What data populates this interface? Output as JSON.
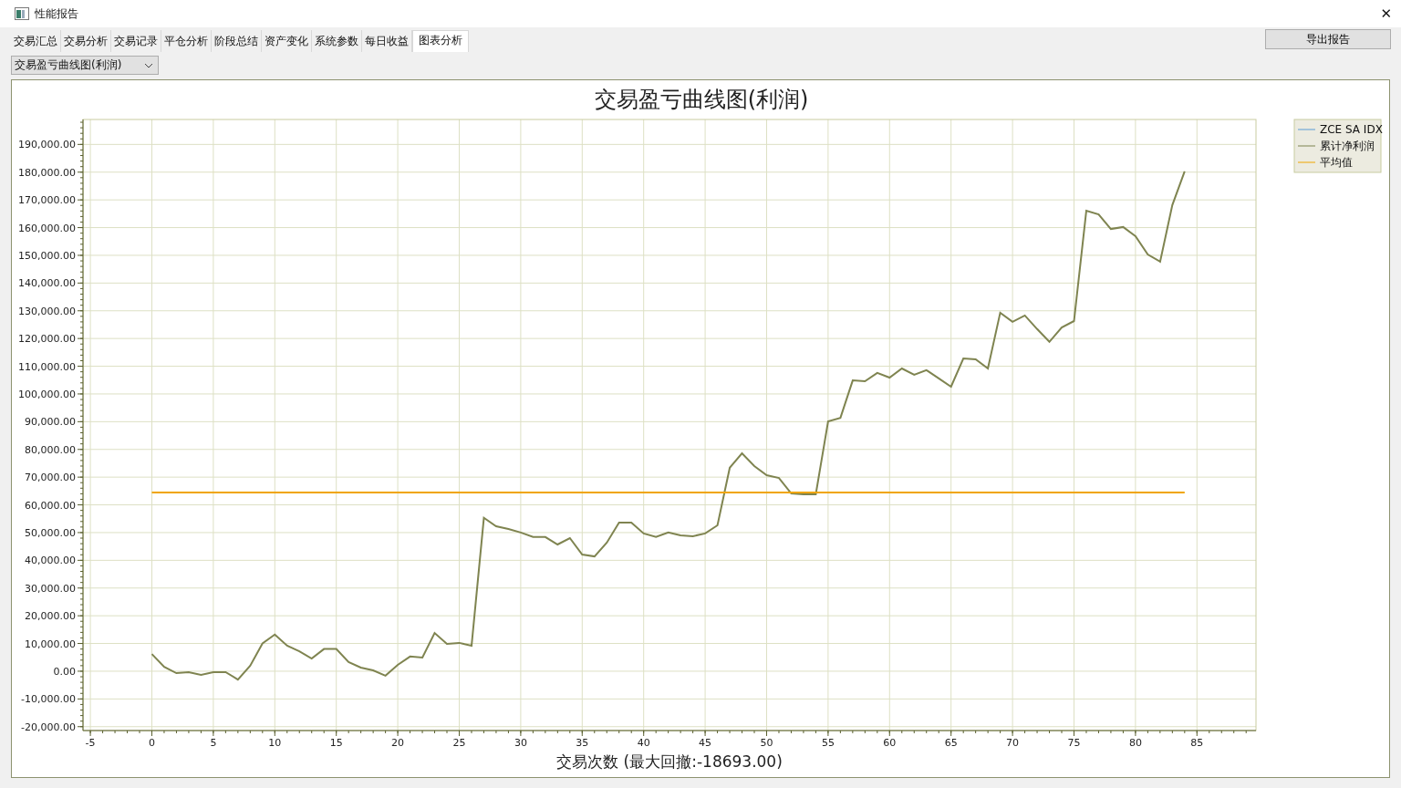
{
  "window": {
    "title": "性能报告",
    "close": "✕"
  },
  "tabs": [
    {
      "label": "交易汇总",
      "selected": false
    },
    {
      "label": "交易分析",
      "selected": false
    },
    {
      "label": "交易记录",
      "selected": false
    },
    {
      "label": "平仓分析",
      "selected": false
    },
    {
      "label": "阶段总结",
      "selected": false
    },
    {
      "label": "资产变化",
      "selected": false
    },
    {
      "label": "系统参数",
      "selected": false
    },
    {
      "label": "每日收益",
      "selected": false
    },
    {
      "label": "图表分析",
      "selected": true
    }
  ],
  "export_button": "导出报告",
  "chart_select": {
    "value": "交易盈亏曲线图(利润)"
  },
  "chart_data": {
    "type": "line",
    "grid": true,
    "legend": "top-right",
    "title": "交易盈亏曲线图(利润)",
    "xlabel": "交易次数 (最大回撤:-18693.00)",
    "x": [
      0,
      1,
      2,
      3,
      4,
      5,
      6,
      7,
      8,
      9,
      10,
      11,
      12,
      13,
      14,
      15,
      16,
      17,
      18,
      19,
      20,
      21,
      22,
      23,
      24,
      25,
      26,
      27,
      28,
      29,
      30,
      31,
      32,
      33,
      34,
      35,
      36,
      37,
      38,
      39,
      40,
      41,
      42,
      43,
      44,
      45,
      46,
      47,
      48,
      49,
      50,
      51,
      52,
      53,
      54,
      55,
      56,
      57,
      58,
      59,
      60,
      61,
      62,
      63,
      64,
      65,
      66,
      67,
      68,
      69,
      70,
      71,
      72,
      73,
      74,
      75,
      76,
      77,
      78,
      79,
      80,
      81,
      82,
      83,
      84
    ],
    "xlim": [
      -5.6,
      89.8
    ],
    "ylim": [
      -21400,
      199000
    ],
    "xticks": [
      -5,
      0,
      5,
      10,
      15,
      20,
      25,
      30,
      35,
      40,
      45,
      50,
      55,
      60,
      65,
      70,
      75,
      80,
      85
    ],
    "yticks": [
      {
        "value": -20000,
        "label": "-20,000.00"
      },
      {
        "value": -10000,
        "label": "-10,000.00"
      },
      {
        "value": 0,
        "label": "0.00"
      },
      {
        "value": 10000,
        "label": "10,000.00"
      },
      {
        "value": 20000,
        "label": "20,000.00"
      },
      {
        "value": 30000,
        "label": "30,000.00"
      },
      {
        "value": 40000,
        "label": "40,000.00"
      },
      {
        "value": 50000,
        "label": "50,000.00"
      },
      {
        "value": 60000,
        "label": "60,000.00"
      },
      {
        "value": 70000,
        "label": "70,000.00"
      },
      {
        "value": 80000,
        "label": "80,000.00"
      },
      {
        "value": 90000,
        "label": "90,000.00"
      },
      {
        "value": 100000,
        "label": "100,000.00"
      },
      {
        "value": 110000,
        "label": "110,000.00"
      },
      {
        "value": 120000,
        "label": "120,000.00"
      },
      {
        "value": 130000,
        "label": "130,000.00"
      },
      {
        "value": 140000,
        "label": "140,000.00"
      },
      {
        "value": 150000,
        "label": "150,000.00"
      },
      {
        "value": 160000,
        "label": "160,000.00"
      },
      {
        "value": 170000,
        "label": "170,000.00"
      },
      {
        "value": 180000,
        "label": "180,000.00"
      },
      {
        "value": 190000,
        "label": "190,000.00"
      }
    ],
    "series": [
      {
        "name": "ZCE SA IDX",
        "color": "#5b9bd5",
        "values": [
          null,
          null,
          null,
          null,
          null,
          null,
          null,
          null,
          null,
          null,
          null,
          null,
          null,
          null,
          null,
          null,
          null,
          null,
          null,
          null,
          null,
          null,
          null,
          null,
          null,
          null,
          null,
          null,
          null,
          null,
          null,
          null,
          null,
          null,
          null,
          null,
          null,
          null,
          null,
          null,
          null,
          null,
          null,
          null,
          null,
          null,
          null,
          null,
          null,
          null,
          null,
          null,
          null,
          null,
          null,
          null,
          null,
          null,
          null,
          null,
          null,
          null,
          null,
          null,
          null,
          null,
          null,
          null,
          null,
          null,
          null,
          null,
          null,
          null,
          null,
          null,
          null,
          null,
          null,
          null,
          null,
          null,
          null,
          null,
          null
        ]
      },
      {
        "name": "累计净利润",
        "color": "#7f8450",
        "values": [
          6200,
          1600,
          -700,
          -300,
          -1300,
          -300,
          -300,
          -3000,
          2000,
          10000,
          13200,
          9200,
          7200,
          4600,
          8000,
          8000,
          3300,
          1300,
          300,
          -1600,
          2300,
          5300,
          4900,
          13800,
          9900,
          10200,
          9200,
          55300,
          52300,
          51300,
          50000,
          48400,
          48400,
          45700,
          48000,
          42100,
          41400,
          46400,
          53600,
          53600,
          49700,
          48400,
          50000,
          49000,
          48700,
          49700,
          52600,
          73400,
          78600,
          74000,
          70700,
          69700,
          64100,
          63800,
          63800,
          90100,
          91400,
          104900,
          104600,
          107600,
          105900,
          109200,
          106900,
          108600,
          105600,
          102600,
          112800,
          112500,
          109200,
          129300,
          126000,
          128300,
          123400,
          118800,
          124000,
          126300,
          166100,
          164800,
          159500,
          160200,
          156900,
          150300,
          147700,
          168100,
          180300
        ]
      },
      {
        "name": "平均值",
        "color": "#f0a500",
        "values": [
          64500,
          64500,
          64500,
          64500,
          64500,
          64500,
          64500,
          64500,
          64500,
          64500,
          64500,
          64500,
          64500,
          64500,
          64500,
          64500,
          64500,
          64500,
          64500,
          64500,
          64500,
          64500,
          64500,
          64500,
          64500,
          64500,
          64500,
          64500,
          64500,
          64500,
          64500,
          64500,
          64500,
          64500,
          64500,
          64500,
          64500,
          64500,
          64500,
          64500,
          64500,
          64500,
          64500,
          64500,
          64500,
          64500,
          64500,
          64500,
          64500,
          64500,
          64500,
          64500,
          64500,
          64500,
          64500,
          64500,
          64500,
          64500,
          64500,
          64500,
          64500,
          64500,
          64500,
          64500,
          64500,
          64500,
          64500,
          64500,
          64500,
          64500,
          64500,
          64500,
          64500,
          64500,
          64500,
          64500,
          64500,
          64500,
          64500,
          64500,
          64500,
          64500,
          64500,
          64500,
          64500
        ]
      }
    ]
  }
}
